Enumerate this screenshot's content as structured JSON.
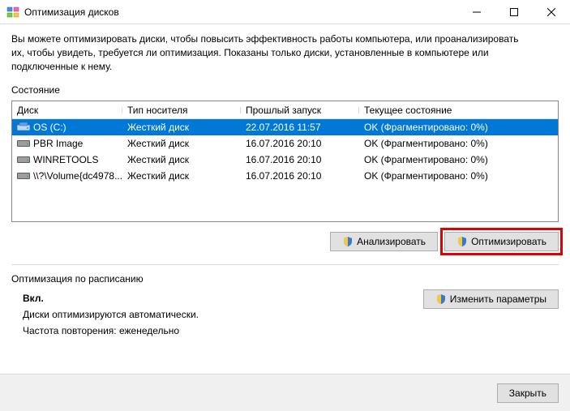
{
  "window": {
    "title": "Оптимизация дисков"
  },
  "intro": {
    "line1": "Вы можете оптимизировать диски, чтобы повысить эффективность работы  компьютера, или проанализировать",
    "line2": "их, чтобы увидеть, требуется ли оптимизация. Показаны только диски, установленные в компьютере или",
    "line3": "подключенные к нему."
  },
  "section": {
    "status_label": "Состояние",
    "schedule_label": "Оптимизация по расписанию"
  },
  "columns": {
    "disk": "Диск",
    "media": "Тип носителя",
    "last_run": "Прошлый запуск",
    "status": "Текущее состояние"
  },
  "rows": [
    {
      "icon": "osdrive",
      "name": "OS (C:)",
      "media": "Жесткий диск",
      "last": "22.07.2016 11:57",
      "status": "OK (Фрагментировано: 0%)",
      "selected": true
    },
    {
      "icon": "hdd",
      "name": "PBR Image",
      "media": "Жесткий диск",
      "last": "16.07.2016 20:10",
      "status": "OK (Фрагментировано: 0%)",
      "selected": false
    },
    {
      "icon": "hdd",
      "name": "WINRETOOLS",
      "media": "Жесткий диск",
      "last": "16.07.2016 20:10",
      "status": "OK (Фрагментировано: 0%)",
      "selected": false
    },
    {
      "icon": "hdd",
      "name": "\\\\?\\Volume{dc4978...",
      "media": "Жесткий диск",
      "last": "16.07.2016 20:10",
      "status": "OK (Фрагментировано: 0%)",
      "selected": false
    }
  ],
  "buttons": {
    "analyze": "Анализировать",
    "optimize": "Оптимизировать",
    "change_params": "Изменить параметры",
    "close": "Закрыть"
  },
  "schedule": {
    "state": "Вкл.",
    "desc": "Диски оптимизируются автоматически.",
    "freq": "Частота повторения: еженедельно"
  }
}
